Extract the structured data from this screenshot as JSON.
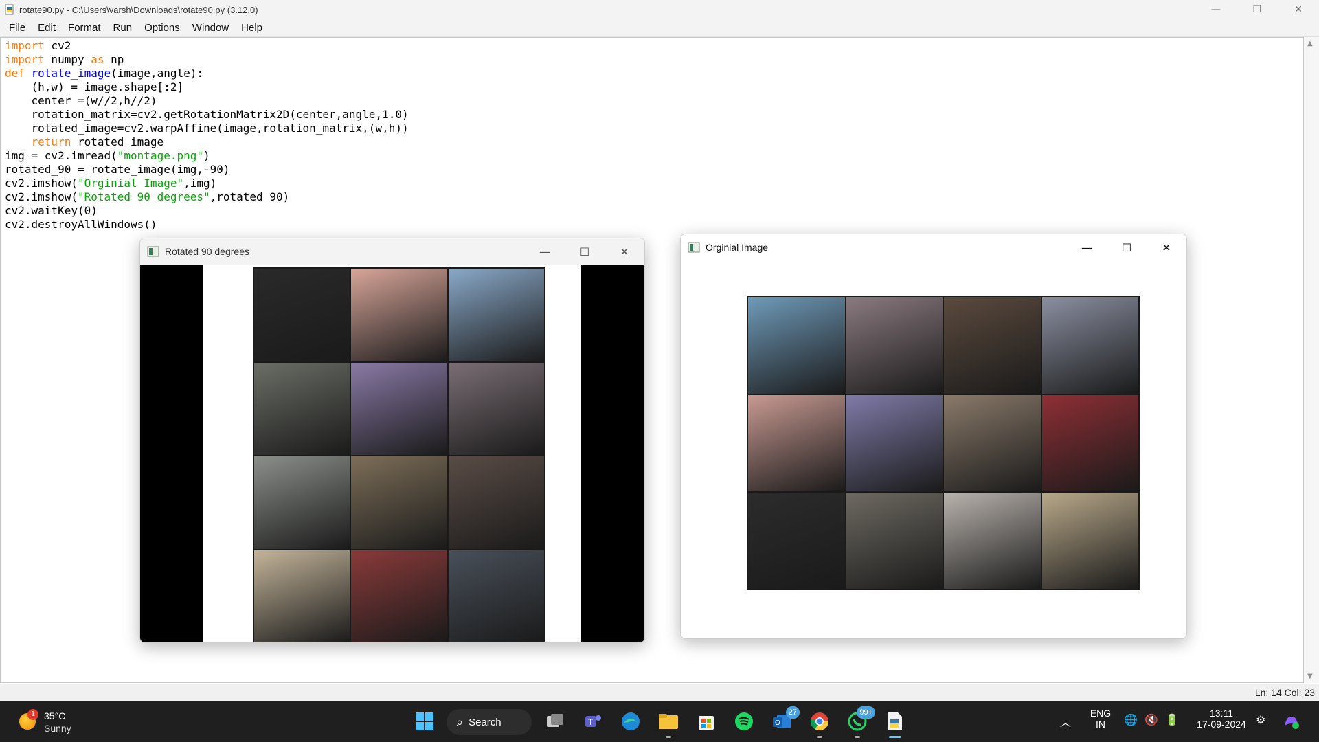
{
  "window": {
    "title": "rotate90.py - C:\\Users\\varsh\\Downloads\\rotate90.py (3.12.0)",
    "controls": {
      "minimize": "—",
      "restore": "❐",
      "close": "✕"
    }
  },
  "menu": [
    "File",
    "Edit",
    "Format",
    "Run",
    "Options",
    "Window",
    "Help"
  ],
  "code_lines": [
    [
      {
        "t": "import",
        "c": "kw"
      },
      {
        "t": " cv2",
        "c": ""
      }
    ],
    [
      {
        "t": "import",
        "c": "kw"
      },
      {
        "t": " numpy ",
        "c": ""
      },
      {
        "t": "as",
        "c": "kw"
      },
      {
        "t": " np",
        "c": ""
      }
    ],
    [
      {
        "t": "def",
        "c": "kw"
      },
      {
        "t": " ",
        "c": ""
      },
      {
        "t": "rotate_image",
        "c": "fn"
      },
      {
        "t": "(image,angle):",
        "c": ""
      }
    ],
    [
      {
        "t": "    (h,w) = image.shape[:2]",
        "c": ""
      }
    ],
    [
      {
        "t": "    center =(w//2,h//2)",
        "c": ""
      }
    ],
    [
      {
        "t": "    rotation_matrix=cv2.getRotationMatrix2D(center,angle,1.0)",
        "c": ""
      }
    ],
    [
      {
        "t": "    rotated_image=cv2.warpAffine(image,rotation_matrix,(w,h))",
        "c": ""
      }
    ],
    [
      {
        "t": "    ",
        "c": ""
      },
      {
        "t": "return",
        "c": "kw"
      },
      {
        "t": " rotated_image",
        "c": ""
      }
    ],
    [
      {
        "t": "img = cv2.imread(",
        "c": ""
      },
      {
        "t": "\"montage.png\"",
        "c": "str"
      },
      {
        "t": ")",
        "c": ""
      }
    ],
    [
      {
        "t": "rotated_90 = rotate_image(img,-90)",
        "c": ""
      }
    ],
    [
      {
        "t": "cv2.imshow(",
        "c": ""
      },
      {
        "t": "\"Orginial Image\"",
        "c": "str"
      },
      {
        "t": ",img)",
        "c": ""
      }
    ],
    [
      {
        "t": "cv2.imshow(",
        "c": ""
      },
      {
        "t": "\"Rotated 90 degrees\"",
        "c": "str"
      },
      {
        "t": ",rotated_90)",
        "c": ""
      }
    ],
    [
      {
        "t": "cv2.waitKey(0)",
        "c": ""
      }
    ],
    [
      {
        "t": "cv2.destroyAllWindows()",
        "c": ""
      }
    ]
  ],
  "status": {
    "position": "Ln: 14   Col: 23"
  },
  "rotated_window": {
    "title": "Rotated 90 degrees",
    "tiles": [
      [
        "#2a2a2a",
        "#d8a69a",
        "#8aa9c8"
      ],
      [
        "#6b6e66",
        "#8a7aa6",
        "#7a6e74"
      ],
      [
        "#8b8f8a",
        "#7d6e58",
        "#5a4c46"
      ],
      [
        "#c4b59a",
        "#8a3a3a",
        "#49505a"
      ]
    ]
  },
  "original_window": {
    "title": "Orginial Image",
    "tiles": [
      [
        "#6f9ab8",
        "#8a7a80",
        "#5b4a3e",
        "#8a8fa0"
      ],
      [
        "#c89a92",
        "#7f7ba8",
        "#8a7a6a",
        "#8e2f35"
      ],
      [
        "#2c2c2c",
        "#6e6a62",
        "#b9b3ad",
        "#b9a98a"
      ]
    ]
  },
  "taskbar": {
    "weather": {
      "badge": "1",
      "temp": "35°C",
      "condition": "Sunny"
    },
    "search_label": "Search",
    "outlook_badge": "27",
    "whatsapp_badge": "99+",
    "language": {
      "line1": "ENG",
      "line2": "IN"
    },
    "clock": {
      "time": "13:11",
      "date": "17-09-2024"
    }
  },
  "colors": {
    "keyword": "#ff7700",
    "function_name": "#0000ff",
    "string": "#00aa00",
    "taskbar_bg": "#1f1f1f"
  }
}
